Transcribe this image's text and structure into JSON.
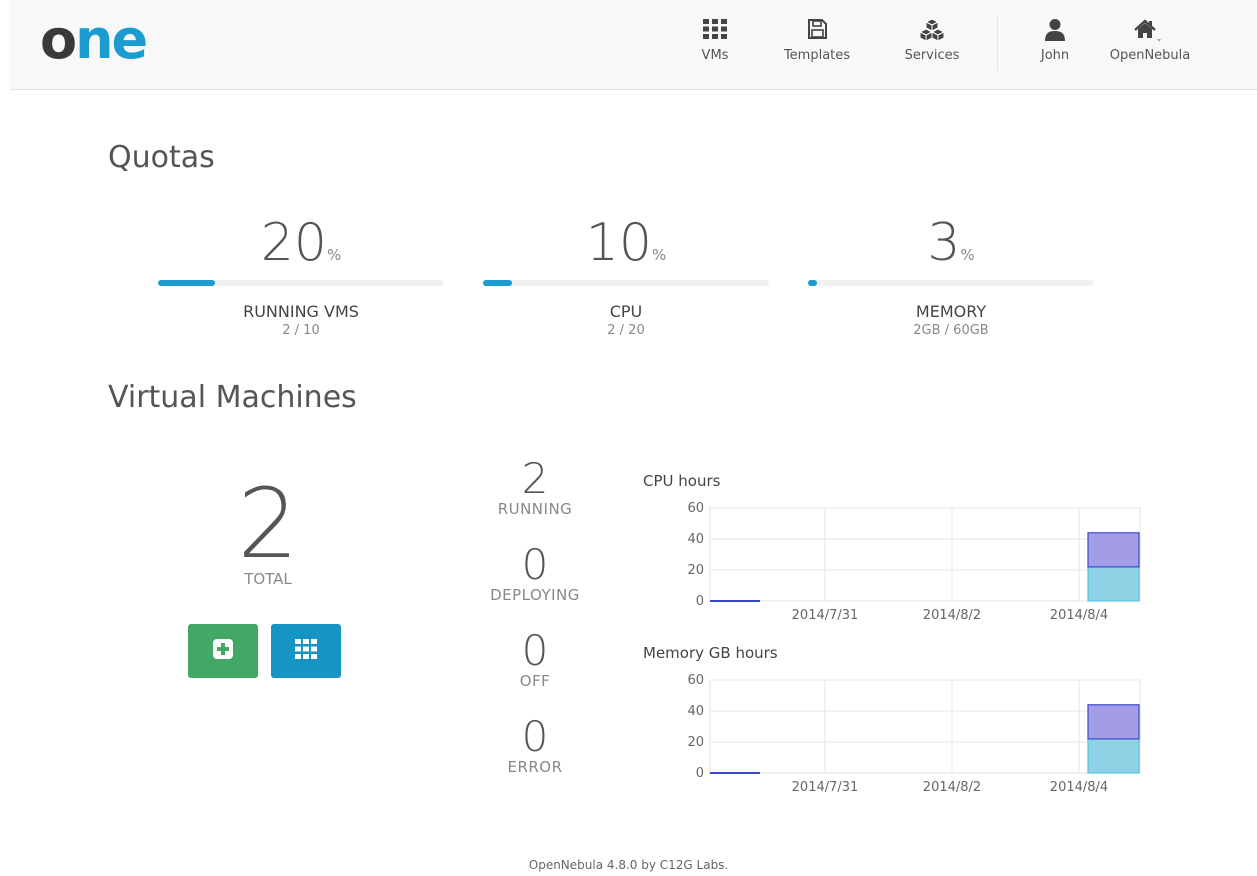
{
  "brand": {
    "logo_o": "o",
    "logo_ne": "ne",
    "accent": "#1c9bd1"
  },
  "nav": {
    "vms": {
      "label": "VMs",
      "icon": "grid-icon"
    },
    "templates": {
      "label": "Templates",
      "icon": "save-icon"
    },
    "services": {
      "label": "Services",
      "icon": "cubes-icon"
    },
    "user": {
      "label": "John",
      "icon": "user-icon"
    },
    "zone": {
      "label": "OpenNebula",
      "icon": "home-icon"
    }
  },
  "quotas": {
    "title": "Quotas",
    "unit": "%",
    "items": [
      {
        "value": "20",
        "label": "RUNNING VMS",
        "sub": "2 / 10",
        "fraction": 0.2
      },
      {
        "value": "10",
        "label": "CPU",
        "sub": "2 / 20",
        "fraction": 0.1
      },
      {
        "value": "3",
        "label": "MEMORY",
        "sub": "2GB / 60GB",
        "fraction": 0.03
      }
    ]
  },
  "vms": {
    "title": "Virtual Machines",
    "total": "2",
    "total_label": "TOTAL",
    "states": [
      {
        "value": "2",
        "label": "RUNNING"
      },
      {
        "value": "0",
        "label": "DEPLOYING"
      },
      {
        "value": "0",
        "label": "OFF"
      },
      {
        "value": "0",
        "label": "ERROR"
      }
    ],
    "buttons": {
      "create_color": "#43a865",
      "list_color": "#1694c3"
    }
  },
  "chart_data": [
    {
      "type": "area",
      "title": "CPU hours",
      "ylim": [
        0,
        60
      ],
      "yticks": [
        "0",
        "20",
        "40",
        "60"
      ],
      "xticks": [
        "2014/7/31",
        "2014/8/2",
        "2014/8/4"
      ],
      "series": [
        {
          "color": "#8fd2e6",
          "segments": [
            {
              "x": "2014/8/4",
              "values": [
                22
              ]
            }
          ]
        },
        {
          "color": "#a39ce6",
          "segments": [
            {
              "x": "2014/8/4",
              "values": [
                22
              ]
            }
          ]
        }
      ],
      "baseline_color": "#3b48c8"
    },
    {
      "type": "area",
      "title": "Memory GB hours",
      "ylim": [
        0,
        60
      ],
      "yticks": [
        "0",
        "20",
        "40",
        "60"
      ],
      "xticks": [
        "2014/7/31",
        "2014/8/2",
        "2014/8/4"
      ],
      "series": [
        {
          "color": "#8fd2e6",
          "segments": [
            {
              "x": "2014/8/4",
              "values": [
                22
              ]
            }
          ]
        },
        {
          "color": "#a39ce6",
          "segments": [
            {
              "x": "2014/8/4",
              "values": [
                22
              ]
            }
          ]
        }
      ],
      "baseline_color": "#3b48c8"
    }
  ],
  "footer": "OpenNebula 4.8.0 by C12G Labs."
}
